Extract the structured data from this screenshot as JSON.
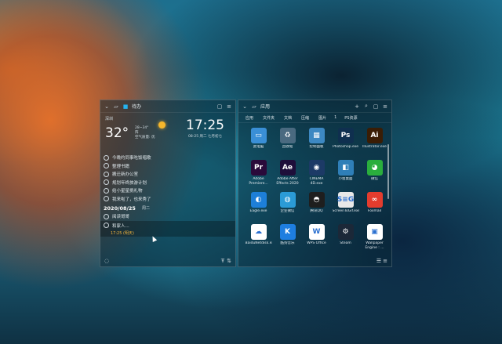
{
  "left_panel": {
    "title": "待办",
    "weather": {
      "city": "深圳",
      "temperature": "32°",
      "range": "28~34°",
      "condition": "阵",
      "air_quality": "空气质量: 优",
      "icon": "sun-icon"
    },
    "clock": {
      "time": "17:25",
      "date": "08-25 周二 七月初七"
    },
    "todos": [
      "今晚约同事吃饭唱歌",
      "整理书籍",
      "搬迁新办公室",
      "规划年终旅游计划",
      "给小星星挑礼物",
      "我来啦了，也来秀了"
    ],
    "section_date": "2020/08/25",
    "section_weekday": "周二",
    "todos2": [
      "阅读哥哥",
      "和家人..."
    ],
    "due_text": "17:25 (明天)"
  },
  "right_panel": {
    "title": "应用",
    "tabs": [
      "应用",
      "文件夹",
      "文档",
      "压缩",
      "图片",
      "1",
      "PS资源"
    ],
    "apps": [
      {
        "label": "此电脑",
        "icon": "computer-icon",
        "glyph": "▭",
        "color": "#3a8fd6"
      },
      {
        "label": "回收站",
        "icon": "recycle-bin-icon",
        "glyph": "♻",
        "color": "#4a6a80"
      },
      {
        "label": "控制面板",
        "icon": "control-panel-icon",
        "glyph": "▦",
        "color": "#3d88c2"
      },
      {
        "label": "Photoshop.exe",
        "icon": "photoshop-icon",
        "glyph": "Ps",
        "color": "#0f2f4f"
      },
      {
        "label": "Illustrator.exe",
        "icon": "illustrator-icon",
        "glyph": "Ai",
        "color": "#3a1d05"
      },
      {
        "label": "Adobe Premiere...",
        "icon": "premiere-icon",
        "glyph": "Pr",
        "color": "#2a0a3a"
      },
      {
        "label": "Adobe After Effects 2020",
        "icon": "after-effects-icon",
        "glyph": "Ae",
        "color": "#1e0e3a"
      },
      {
        "label": "CINEMA 4D.exe",
        "icon": "cinema4d-icon",
        "glyph": "◉",
        "color": "#1c3a66"
      },
      {
        "label": "小窗桌面",
        "icon": "desktop-icon",
        "glyph": "◧",
        "color": "#2f7fb8"
      },
      {
        "label": "微信",
        "icon": "wechat-icon",
        "glyph": "◕",
        "color": "#2aae3d"
      },
      {
        "label": "Eagle.exe",
        "icon": "eagle-icon",
        "glyph": "◐",
        "color": "#1d7fd8"
      },
      {
        "label": "企业微信",
        "icon": "wecom-icon",
        "glyph": "◍",
        "color": "#2b9bd6"
      },
      {
        "label": "腾讯QQ",
        "icon": "qq-icon",
        "glyph": "◓",
        "color": "#1e1e1e"
      },
      {
        "label": "ScreenToGif.exe",
        "icon": "screentogif-icon",
        "glyph": "S≡G",
        "color": "#e8e8e8"
      },
      {
        "label": "Foxmail",
        "icon": "foxmail-icon",
        "glyph": "∞",
        "color": "#e33c2e"
      },
      {
        "label": "BaiduNetdisk.exe",
        "icon": "baidu-netdisk-icon",
        "glyph": "☁",
        "color": "#ffffff"
      },
      {
        "label": "酷狗音乐",
        "icon": "kugou-icon",
        "glyph": "K",
        "color": "#1e7ee0"
      },
      {
        "label": "WPS Office",
        "icon": "wps-icon",
        "glyph": "W",
        "color": "#ffffff"
      },
      {
        "label": "Steam",
        "icon": "steam-icon",
        "glyph": "⚙",
        "color": "#1b2838"
      },
      {
        "label": "Wallpaper Engine : ...",
        "icon": "wallpaper-engine-icon",
        "glyph": "▣",
        "color": "#ffffff"
      }
    ]
  }
}
